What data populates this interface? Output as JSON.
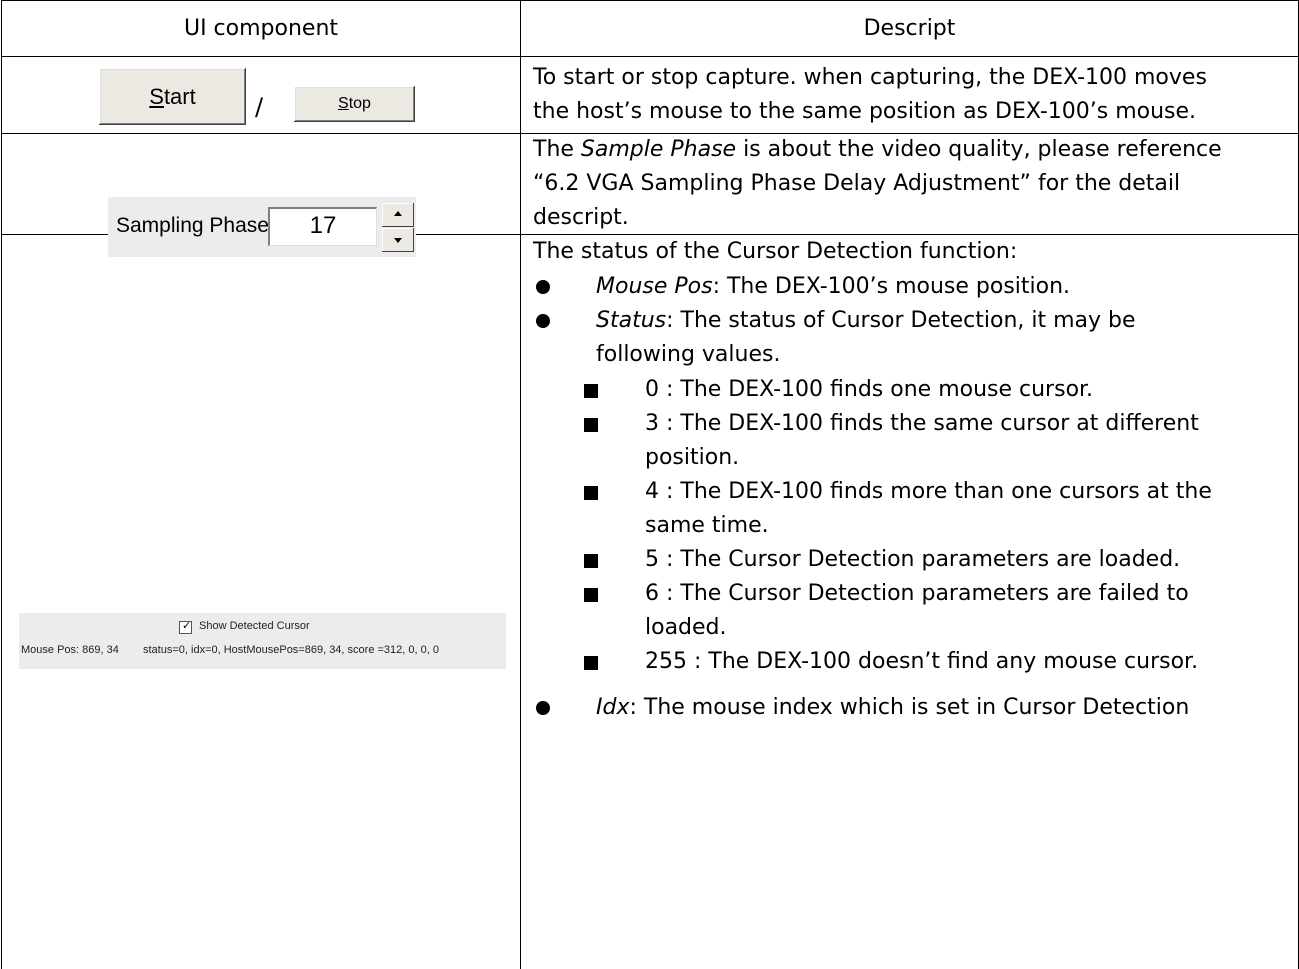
{
  "header": {
    "col1": "UI component",
    "col2": "Descript"
  },
  "row1": {
    "start_button": {
      "mnemonic": "S",
      "rest": "tart"
    },
    "separator": "/",
    "stop_button": {
      "mnemonic": "S",
      "rest": "top"
    },
    "desc_line1": "To start or stop capture. when capturing, the DEX-100 moves",
    "desc_line2": "the host’s mouse to the same position as DEX-100’s mouse."
  },
  "row2": {
    "label": "Sampling Phase:",
    "value": "17",
    "desc_line1_pre": "The ",
    "desc_line1_em": "Sample Phase",
    "desc_line1_post": " is about the video quality, please reference",
    "desc_line2": "“6.2  VGA Sampling Phase Delay Adjustment” for the detail",
    "desc_line3": "descript."
  },
  "row3": {
    "checkbox_label": "Show Detected Cursor",
    "checkbox_checked": true,
    "mouse_pos_text": "Mouse Pos: 869, 34",
    "status_text": "status=0, idx=0, HostMousePos=869, 34, score =312, 0, 0, 0",
    "intro": "The status of the Cursor Detection function:",
    "bullets": [
      {
        "em": "Mouse Pos",
        "text": ": The DEX-100’s mouse position."
      },
      {
        "em": "Status",
        "text": ": The status of Cursor Detection, it may be",
        "cont": "following values."
      },
      {
        "em": "Idx",
        "text": ": The mouse index which is set in Cursor Detection"
      }
    ],
    "sub_items": [
      {
        "line1": "0 : The DEX-100 finds one mouse cursor."
      },
      {
        "line1": "3 : The DEX-100 finds the same cursor at different",
        "line2": "position."
      },
      {
        "line1": "4 : The DEX-100 finds more than one cursors at the",
        "line2": "same time."
      },
      {
        "line1": "5 : The Cursor Detection parameters are loaded."
      },
      {
        "line1": "6 : The Cursor Detection parameters are failed to",
        "line2": "loaded."
      },
      {
        "line1": "255 :    The DEX-100 doesn’t find any mouse cursor."
      }
    ]
  }
}
